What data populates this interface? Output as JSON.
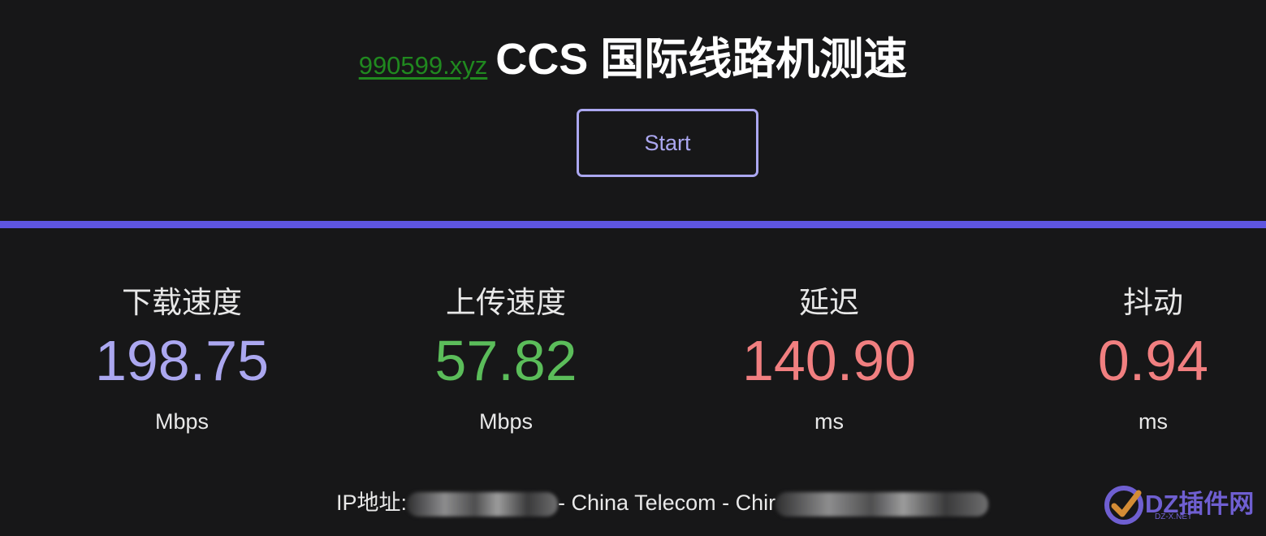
{
  "header": {
    "site_link": "990599.xyz",
    "title": "CCS 国际线路机测速"
  },
  "controls": {
    "start_label": "Start"
  },
  "metrics": [
    {
      "label": "下载速度",
      "value": "198.75",
      "unit": "Mbps",
      "color": "#aba7f0"
    },
    {
      "label": "上传速度",
      "value": "57.82",
      "unit": "Mbps",
      "color": "#5bbd5a"
    },
    {
      "label": "延迟",
      "value": "140.90",
      "unit": "ms",
      "color": "#f17f80"
    },
    {
      "label": "抖动",
      "value": "0.94",
      "unit": "ms",
      "color": "#f17f80"
    }
  ],
  "ip_info": {
    "label": "IP地址:",
    "isp": "- China Telecom - Chir"
  },
  "watermark": {
    "text": "DZ插件网",
    "subtext": "DZ-X.NET"
  },
  "colors": {
    "background": "#171718",
    "accent": "#5e55e0",
    "link": "#20891f"
  }
}
